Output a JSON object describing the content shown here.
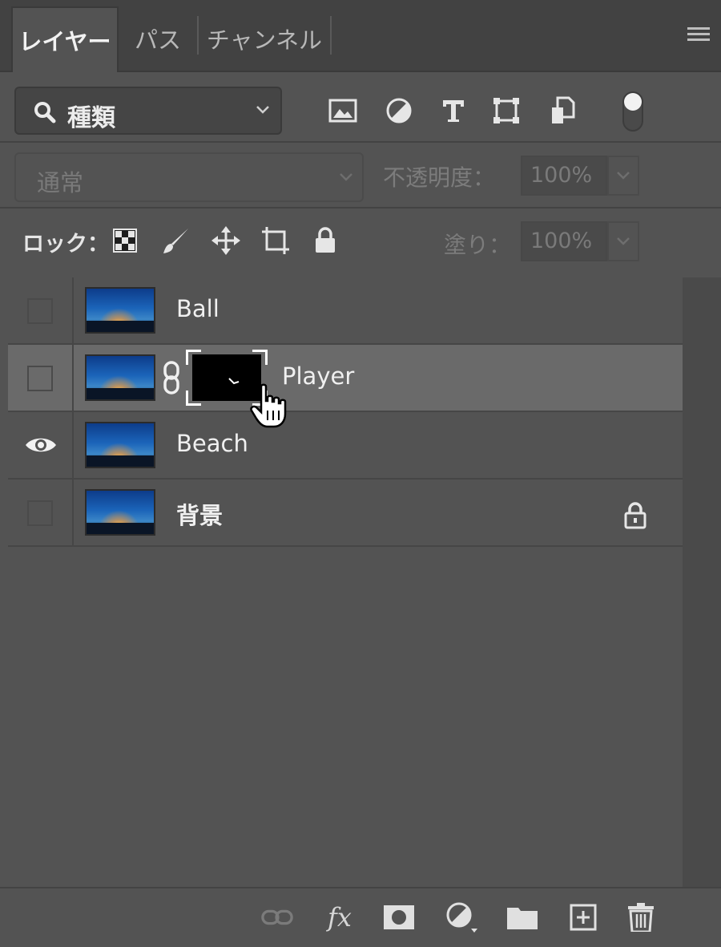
{
  "tabs": [
    {
      "label": "レイヤー",
      "active": true
    },
    {
      "label": "パス",
      "active": false
    },
    {
      "label": "チャンネル",
      "active": false
    }
  ],
  "filter": {
    "selected": "種類",
    "icon": "search-icon"
  },
  "filter_icons": [
    "image-filter-icon",
    "adjustment-filter-icon",
    "type-filter-icon",
    "shape-filter-icon",
    "smart-object-filter-icon",
    "filter-toggle-icon"
  ],
  "blend": {
    "mode": "通常",
    "opacity_label": "不透明度：",
    "opacity_value": "100%"
  },
  "lock": {
    "label": "ロック：",
    "fill_label": "塗り：",
    "fill_value": "100%",
    "icons": [
      "lock-transparent-icon",
      "lock-image-icon",
      "lock-position-icon",
      "lock-artboard-icon",
      "lock-all-icon"
    ]
  },
  "layers": [
    {
      "name": "Ball",
      "visible": false,
      "selected": false,
      "mask": false,
      "locked": false
    },
    {
      "name": "Player",
      "visible": false,
      "selected": true,
      "mask": true,
      "locked": false
    },
    {
      "name": "Beach",
      "visible": true,
      "selected": false,
      "mask": false,
      "locked": false
    },
    {
      "name": "背景",
      "visible": false,
      "selected": false,
      "mask": false,
      "locked": true
    }
  ],
  "bottom_icons": [
    "link-layers-icon",
    "fx-icon",
    "add-mask-icon",
    "adjustment-layer-icon",
    "new-group-icon",
    "new-layer-icon",
    "delete-layer-icon"
  ],
  "bottom": {
    "fx_label": "fx"
  },
  "colors": {
    "panel": "#535353",
    "tabbar": "#424242",
    "selected_row": "#6a6a6a",
    "text": "#f0f0f0"
  }
}
